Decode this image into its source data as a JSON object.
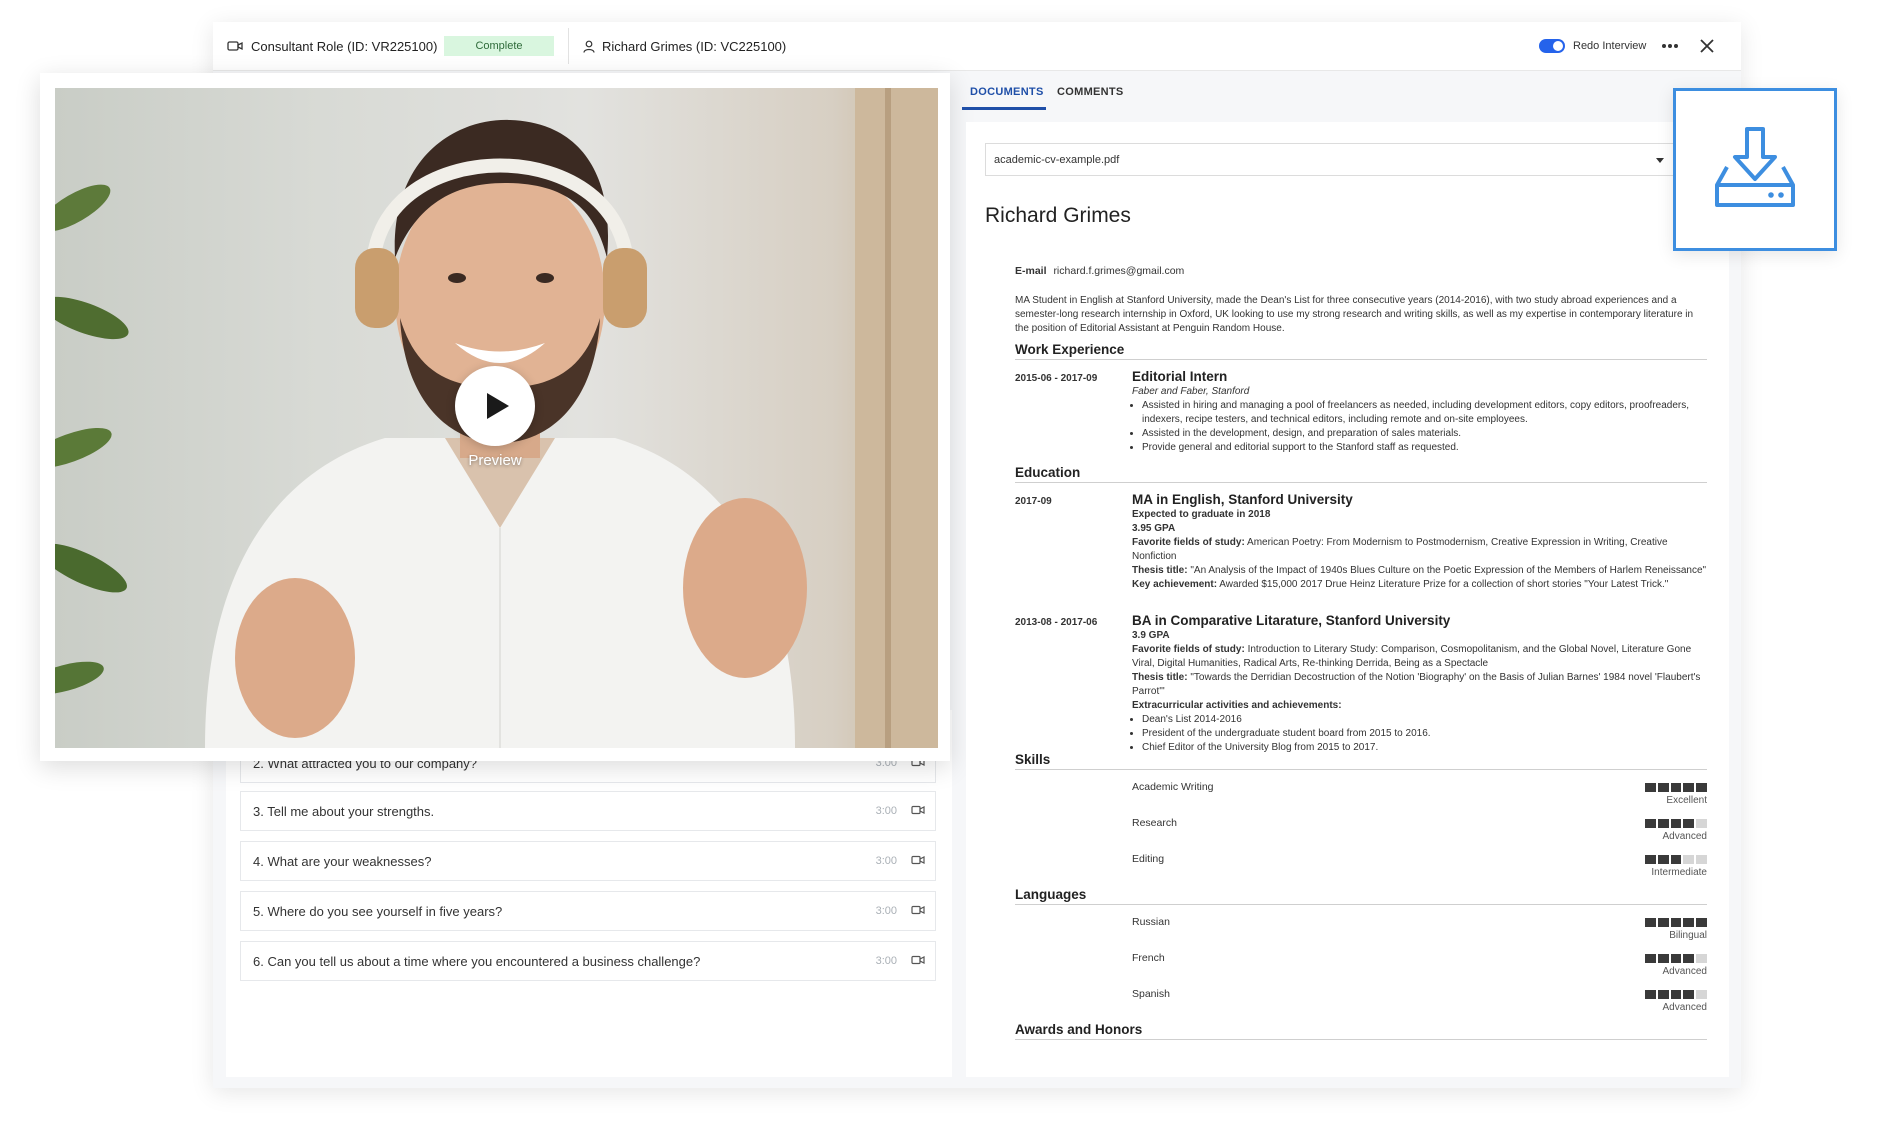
{
  "header": {
    "role_label": "Consultant Role (ID: VR225100)",
    "status_badge": "Complete",
    "candidate_label": "Richard Grimes (ID: VC225100)",
    "redo_label": "Redo Interview"
  },
  "video": {
    "preview_label": "Preview"
  },
  "questions": [
    {
      "text": "2. What attracted you to our company?",
      "time": "3:00"
    },
    {
      "text": "3. Tell me about your strengths.",
      "time": "3:00"
    },
    {
      "text": "4. What are your weaknesses?",
      "time": "3:00"
    },
    {
      "text": "5. Where do you see yourself in five years?",
      "time": "3:00"
    },
    {
      "text": "6. Can you tell us about a time where you encountered a business challenge?",
      "time": "3:00"
    }
  ],
  "tabs": {
    "documents": "DOCUMENTS",
    "comments": "COMMENTS"
  },
  "document_select": {
    "value": "academic-cv-example.pdf"
  },
  "cv": {
    "name": "Richard Grimes",
    "email_label": "E-mail",
    "email": "richard.f.grimes@gmail.com",
    "summary": "MA Student in English at Stanford University, made the Dean's List for three consecutive years (2014-2016), with two study abroad experiences and a semester-long research internship in Oxford, UK looking to use my strong research and writing skills, as well as my expertise in contemporary literature in the position of Editorial Assistant at Penguin Random House.",
    "work_heading": "Work Experience",
    "work": {
      "dates": "2015-06 - 2017-09",
      "title": "Editorial Intern",
      "company": "Faber and Faber, Stanford",
      "bullets": [
        "Assisted in hiring and managing a pool of freelancers as needed, including development editors, copy editors, proofreaders, indexers, recipe testers, and technical editors, including remote and on-site employees.",
        "Assisted in the development, design, and preparation of sales materials.",
        "Provide general and editorial support to the Stanford staff as requested."
      ]
    },
    "education_heading": "Education",
    "edu1": {
      "dates": "2017-09",
      "title": "MA in English, Stanford University",
      "expected": "Expected to graduate in 2018",
      "gpa": "3.95 GPA",
      "fav_label": "Favorite fields of study:",
      "fav": "American Poetry: From Modernism to Postmodernism, Creative Expression in Writing, Creative Nonfiction",
      "thesis_label": "Thesis title:",
      "thesis": "\"An Analysis of the Impact of 1940s Blues Culture on the Poetic Expression of the Members of Harlem Reneissance\"",
      "key_label": "Key achievement:",
      "key": "Awarded $15,000 2017 Drue Heinz Literature Prize for a collection of short stories \"Your Latest Trick.\""
    },
    "edu2": {
      "dates": "2013-08 - 2017-06",
      "title": "BA in Comparative Litarature, Stanford University",
      "gpa": "3.9 GPA",
      "fav_label": "Favorite fields of study:",
      "fav": "Introduction to Literary Study: Comparison, Cosmopolitanism, and the Global Novel, Literature Gone Viral, Digital Humanities, Radical Arts, Re-thinking Derrida, Being as a Spectacle",
      "thesis_label": "Thesis title:",
      "thesis": "\"Towards the Derridian Decostruction of the Notion 'Biography' on the Basis of Julian Barnes' 1984 novel 'Flaubert's Parrot'\"",
      "extra_label": "Extracurricular activities and achievements:",
      "bullets": [
        "Dean's List 2014-2016",
        "President of the undergraduate student board from 2015 to 2016.",
        "Chief Editor of the University Blog from 2015 to 2017."
      ]
    },
    "skills_heading": "Skills",
    "skills": [
      {
        "name": "Academic Writing",
        "level": "Excellent",
        "score": 5
      },
      {
        "name": "Research",
        "level": "Advanced",
        "score": 4
      },
      {
        "name": "Editing",
        "level": "Intermediate",
        "score": 3
      }
    ],
    "languages_heading": "Languages",
    "languages": [
      {
        "name": "Russian",
        "level": "Bilingual",
        "score": 5
      },
      {
        "name": "French",
        "level": "Advanced",
        "score": 4
      },
      {
        "name": "Spanish",
        "level": "Advanced",
        "score": 4
      }
    ],
    "awards_heading": "Awards and Honors"
  },
  "colors": {
    "accent": "#2563eb",
    "download_border": "#3d8ee0",
    "badge_bg": "#d9f6df"
  }
}
